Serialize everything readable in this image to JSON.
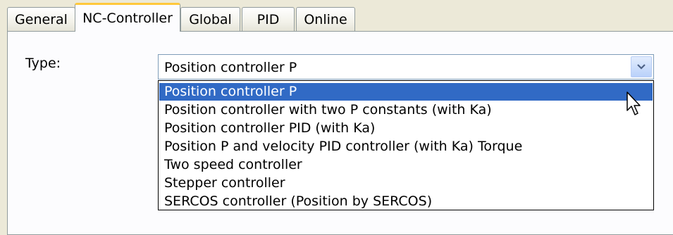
{
  "tabs": [
    {
      "label": "General"
    },
    {
      "label": "NC-Controller"
    },
    {
      "label": "Global"
    },
    {
      "label": "PID"
    },
    {
      "label": "Online"
    }
  ],
  "active_tab": "NC-Controller",
  "type_field": {
    "label": "Type:",
    "value": "Position controller P",
    "options": [
      "Position controller P",
      "Position controller with two P constants (with Ka)",
      "Position controller PID (with Ka)",
      "Position P and velocity PID controller (with Ka) Torque",
      "Two speed controller",
      "Stepper controller",
      "SERCOS controller (Position by SERCOS)"
    ],
    "highlighted_option": "Position controller P"
  },
  "icons": {
    "combo_arrow": "chevron-down-icon",
    "cursor": "mouse-pointer-icon"
  },
  "colors": {
    "selection": "#316ac5",
    "active_tab_accent": "#ffc83c"
  }
}
